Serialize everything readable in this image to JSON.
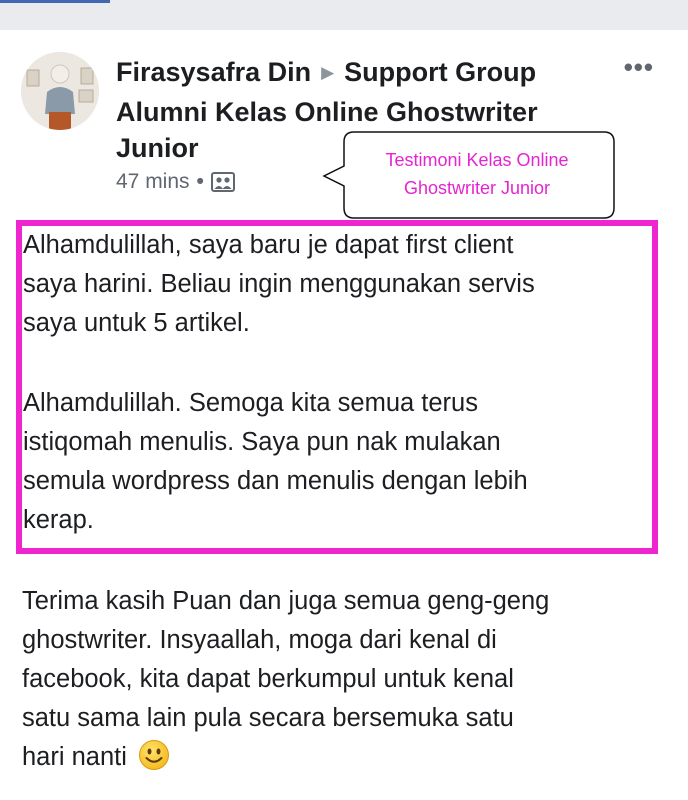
{
  "post": {
    "author": "Firasysafra Din",
    "group_lines": [
      "Support Group",
      "Alumni Kelas Online Ghostwriter",
      "Junior"
    ],
    "time": "47 mins",
    "audience_icon": "group-icon",
    "more_icon": "more-options-icon",
    "more_label": "•••"
  },
  "annotation": {
    "lines": [
      "Testimoni Kelas Online",
      "Ghostwriter Junior"
    ],
    "color": "#e524d1",
    "box_color": "#ef26cf"
  },
  "body": {
    "paragraph1": [
      "Alhamdulillah, saya baru je dapat first client",
      "saya harini. Beliau ingin menggunakan servis",
      "saya untuk 5 artikel."
    ],
    "paragraph2": [
      "Alhamdulillah. Semoga kita semua terus",
      "istiqomah menulis. Saya pun nak mulakan",
      "semula wordpress dan menulis dengan lebih",
      "kerap."
    ],
    "paragraph3": [
      "Terima kasih Puan dan juga semua geng-geng",
      "ghostwriter. Insyaallah, moga dari kenal di",
      "facebook, kita dapat berkumpul untuk kenal",
      "satu sama lain pula secara bersemuka satu",
      "hari nanti"
    ],
    "emoji_icon": "smiley-emoji-icon"
  }
}
